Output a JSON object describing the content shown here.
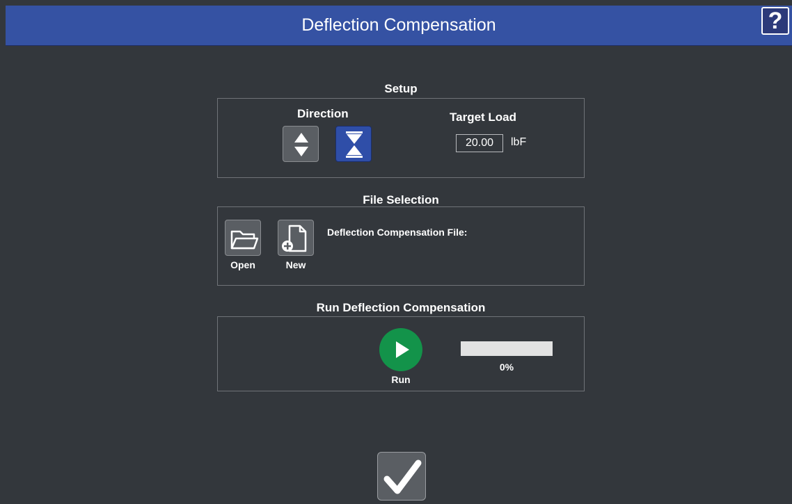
{
  "header": {
    "title": "Deflection Compensation",
    "help_icon": "question-mark-icon"
  },
  "setup": {
    "title": "Setup",
    "direction_label": "Direction",
    "direction_options": [
      {
        "icon": "tension-arrows-icon",
        "selected": false
      },
      {
        "icon": "compression-arrows-icon",
        "selected": true
      }
    ],
    "target_load_label": "Target Load",
    "target_load_value": "20.00",
    "target_load_unit": "lbF"
  },
  "file_selection": {
    "title": "File Selection",
    "open_label": "Open",
    "new_label": "New",
    "file_label": "Deflection Compensation File:"
  },
  "run": {
    "title": "Run Deflection Compensation",
    "run_label": "Run",
    "progress_value": 0,
    "progress_text": "0%"
  },
  "footer": {
    "ok_icon": "checkmark-icon"
  },
  "colors": {
    "header": "#3552a3",
    "background": "#33373c",
    "run": "#13934a",
    "selected": "#2f4ea8"
  }
}
